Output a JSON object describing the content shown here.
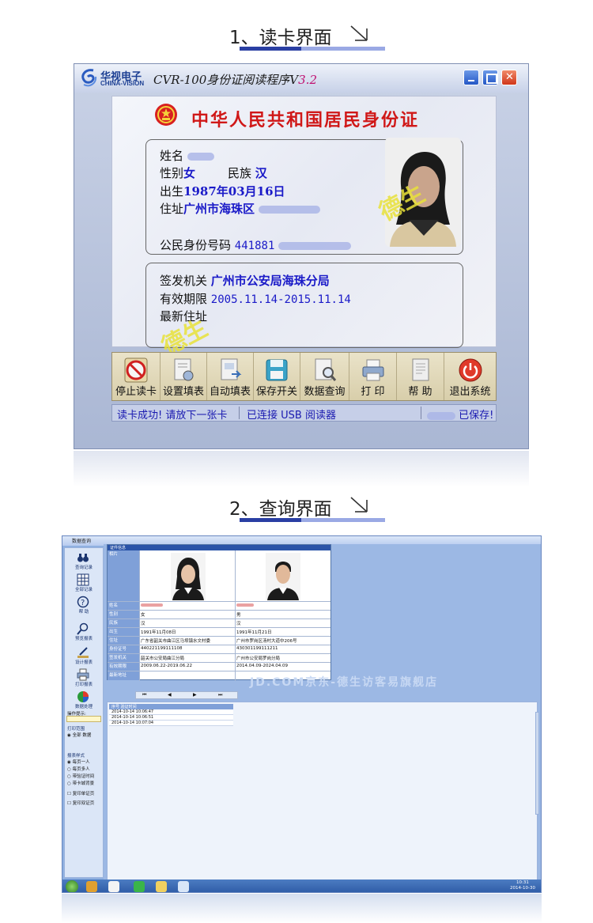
{
  "section1": {
    "title": "1、读卡界面"
  },
  "section2": {
    "title": "2、查询界面"
  },
  "reader": {
    "brand_cn": "华视电子",
    "brand_en": "CHINA-VISION",
    "title_prefix": "CVR-100身份证阅读程序V",
    "title_version": "3.2",
    "card": {
      "header": "中华人民共和国居民身份证",
      "name_label": "姓名",
      "gender_label": "性别",
      "gender_value": "女",
      "ethnicity_label": "民族",
      "ethnicity_value": "汉",
      "birth_label": "出生",
      "birth_value": "1987年03月16日",
      "address_label": "住址",
      "address_value": "广州市海珠区",
      "id_label": "公民身份号码",
      "id_value": "441881",
      "issuer_label": "签发机关",
      "issuer_value": "广州市公安局海珠分局",
      "validity_label": "有效期限",
      "validity_value": "2005.11.14-2015.11.14",
      "new_address_label": "最新住址",
      "watermark": "德生"
    },
    "toolbar": [
      {
        "label": "停止读卡",
        "icon": "stop-icon"
      },
      {
        "label": "设置填表",
        "icon": "settings-form-icon"
      },
      {
        "label": "自动填表",
        "icon": "auto-fill-icon"
      },
      {
        "label": "保存开关",
        "icon": "save-disk-icon"
      },
      {
        "label": "数据查询",
        "icon": "search-doc-icon"
      },
      {
        "label": "打 印",
        "icon": "printer-icon"
      },
      {
        "label": "帮 助",
        "icon": "help-icon"
      },
      {
        "label": "退出系统",
        "icon": "power-icon"
      }
    ],
    "status": {
      "read": "读卡成功! 请放下一张卡",
      "device": "已连接 USB 阅读器",
      "saved": "已保存!"
    },
    "colors": {
      "accent_red": "#d01818",
      "value_blue": "#1a1ac8"
    }
  },
  "query": {
    "window_title": "数据查询",
    "sidebar": {
      "items": [
        {
          "label": "查询记录",
          "icon": "binoculars-icon"
        },
        {
          "label": "全部记录",
          "icon": "grid-icon"
        },
        {
          "label": "帮 助",
          "icon": "help-icon"
        },
        {
          "label": "预览报表",
          "icon": "magnifier-icon"
        },
        {
          "label": "设计报表",
          "icon": "pen-icon"
        },
        {
          "label": "打印报表",
          "icon": "printer-icon"
        },
        {
          "label": "数据处理",
          "icon": "pie-chart-icon"
        }
      ],
      "hint_label": "操作提示:",
      "print_range_label": "打印范围",
      "print_range_options": [
        "全部",
        "数据"
      ],
      "report_style_label": "报表样式",
      "report_styles": [
        "每页一人",
        "每页多人",
        "带验证时间",
        "带卡城背景"
      ],
      "extra_options": [
        "复印单证页",
        "复印双证页"
      ]
    },
    "table": {
      "header": "证件信息",
      "photo_label": "相片",
      "fields": [
        "姓名",
        "性别",
        "民族",
        "出生",
        "住址",
        "身份证号",
        "签发机关",
        "有效期限",
        "最新地址"
      ],
      "person1": {
        "gender": "女",
        "ethnicity": "汉",
        "birth": "1991年11月08日",
        "address": "广东省韶关市曲江区马坝镇水文村委",
        "id": "440221199111108",
        "issuer": "韶关市公安局曲江分局",
        "validity": "2009.06.22-2019.06.22"
      },
      "person2": {
        "gender": "男",
        "ethnicity": "汉",
        "birth": "1991年11月21日",
        "address": "广州市罗岗区汤村大道中206号",
        "id": "430301199111211",
        "issuer": "广州市公安局罗岗分局",
        "validity": "2014.04.09-2024.04.09"
      }
    },
    "pager": [
      "⏮",
      "◀",
      "▶",
      "⏭"
    ],
    "watermark": "JD.COM京东-德生访客易旗舰店",
    "log": {
      "header": "序号  验证时间",
      "rows": [
        "2014-10-14 10:06:47",
        "2014-10-14 10:06:51",
        "2014-10-14 10:07:04"
      ]
    },
    "clock": {
      "time": "10:31",
      "date": "2014-10-30"
    }
  }
}
